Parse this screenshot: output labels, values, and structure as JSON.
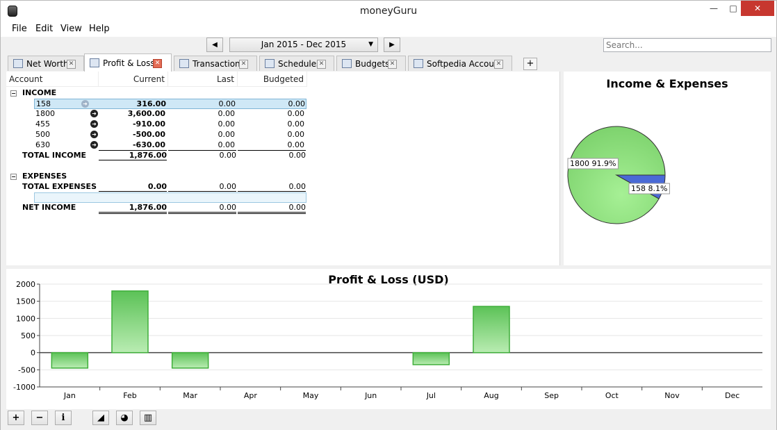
{
  "window": {
    "title": "moneyGuru",
    "minimize": "—",
    "maximize": "□",
    "close": "✕"
  },
  "menu": [
    "File",
    "Edit",
    "View",
    "Help"
  ],
  "nav": {
    "prev": "◀",
    "next": "▶",
    "date_range": "Jan 2015 - Dec 2015",
    "caret": "▼"
  },
  "search": {
    "placeholder": "Search..."
  },
  "tabs": [
    {
      "label": "Net Worth",
      "icon": "chart-icon",
      "close": "✕"
    },
    {
      "label": "Profit & Loss",
      "icon": "bar-chart-icon",
      "close": "✕",
      "active": true
    },
    {
      "label": "Transactions",
      "icon": "ledger-icon",
      "close": "✕"
    },
    {
      "label": "Schedules",
      "icon": "clock-icon",
      "close": "✕"
    },
    {
      "label": "Budgets",
      "icon": "money-icon",
      "close": "✕"
    },
    {
      "label": "Softpedia Account",
      "icon": "document-icon",
      "close": "✕"
    }
  ],
  "add_tab": "+",
  "sheet": {
    "columns": [
      "Account",
      "Current",
      "Last",
      "Budgeted"
    ],
    "income_header": "INCOME",
    "income_rows": [
      {
        "name": "158",
        "current": "316.00",
        "last": "0.00",
        "budgeted": "0.00"
      },
      {
        "name": "1800",
        "current": "3,600.00",
        "last": "0.00",
        "budgeted": "0.00"
      },
      {
        "name": "455",
        "current": "-910.00",
        "last": "0.00",
        "budgeted": "0.00"
      },
      {
        "name": "500",
        "current": "-500.00",
        "last": "0.00",
        "budgeted": "0.00"
      },
      {
        "name": "630",
        "current": "-630.00",
        "last": "0.00",
        "budgeted": "0.00"
      }
    ],
    "total_income": {
      "label": "TOTAL INCOME",
      "current": "1,876.00",
      "last": "0.00",
      "budgeted": "0.00"
    },
    "expenses_header": "EXPENSES",
    "total_expenses": {
      "label": "TOTAL EXPENSES",
      "current": "0.00",
      "last": "0.00",
      "budgeted": "0.00"
    },
    "net_income": {
      "label": "NET INCOME",
      "current": "1,876.00",
      "last": "0.00",
      "budgeted": "0.00"
    },
    "collapse_glyph": "−",
    "go_glyph": "➜"
  },
  "pie": {
    "title": "Income & Expenses",
    "slices": [
      {
        "label": "1800 91.9%",
        "value": 91.9,
        "color": "#7ed36e"
      },
      {
        "label": "158 8.1%",
        "value": 8.1,
        "color": "#4a6ad6"
      }
    ]
  },
  "chart_data": {
    "type": "bar",
    "title": "Profit & Loss (USD)",
    "categories": [
      "Jan",
      "Feb",
      "Mar",
      "Apr",
      "May",
      "Jun",
      "Jul",
      "Aug",
      "Sep",
      "Oct",
      "Nov",
      "Dec"
    ],
    "values": [
      -450,
      1800,
      -450,
      0,
      0,
      0,
      -350,
      1350,
      0,
      0,
      0,
      0
    ],
    "ylim": [
      -1000,
      2000
    ],
    "yticks": [
      2000,
      1500,
      1000,
      500,
      0,
      -500,
      -1000
    ],
    "color": "#3fae3a",
    "grid": true
  },
  "bottom_buttons": [
    {
      "glyph": "+",
      "icon": "add-icon"
    },
    {
      "glyph": "−",
      "icon": "remove-icon"
    },
    {
      "glyph": "i",
      "icon": "info-icon"
    },
    {
      "glyph": "◢",
      "icon": "line-graph-icon"
    },
    {
      "glyph": "◕",
      "icon": "pie-chart-icon"
    },
    {
      "glyph": "▥",
      "icon": "bar-graph-icon"
    }
  ]
}
